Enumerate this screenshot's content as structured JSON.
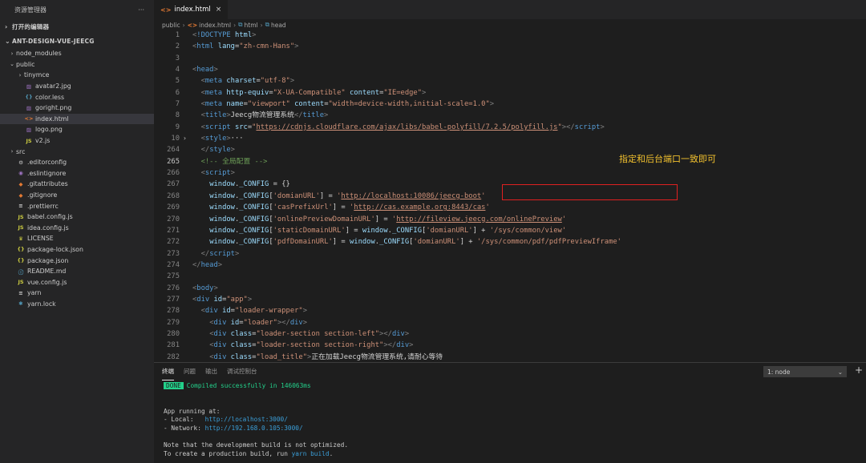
{
  "sidebar": {
    "title": "资源管理器",
    "more": "···",
    "open_editors": "打开的编辑器",
    "project": "ANT-DESIGN-VUE-JEECG",
    "items": [
      {
        "label": "node_modules",
        "chev": "›",
        "icon": "",
        "level": 0,
        "color": "#cccccc"
      },
      {
        "label": "public",
        "chev": "⌄",
        "icon": "",
        "level": 0,
        "color": "#cccccc"
      },
      {
        "label": "tinymce",
        "chev": "›",
        "icon": "",
        "level": 1,
        "color": "#cccccc"
      },
      {
        "label": "avatar2.jpg",
        "chev": "",
        "icon": "▨",
        "level": 1,
        "color": "#a074c4"
      },
      {
        "label": "color.less",
        "chev": "",
        "icon": "{}",
        "level": 1,
        "color": "#519aba"
      },
      {
        "label": "goright.png",
        "chev": "",
        "icon": "▨",
        "level": 1,
        "color": "#a074c4"
      },
      {
        "label": "index.html",
        "chev": "",
        "icon": "<>",
        "level": 1,
        "color": "#e37933",
        "selected": true
      },
      {
        "label": "logo.png",
        "chev": "",
        "icon": "▨",
        "level": 1,
        "color": "#a074c4"
      },
      {
        "label": "v2.js",
        "chev": "",
        "icon": "JS",
        "level": 1,
        "color": "#cbcb41"
      },
      {
        "label": "src",
        "chev": "›",
        "icon": "",
        "level": 0,
        "color": "#cccccc"
      },
      {
        "label": ".editorconfig",
        "chev": "",
        "icon": "⚙",
        "level": 0,
        "color": "#cccccc"
      },
      {
        "label": ".eslintignore",
        "chev": "",
        "icon": "◉",
        "level": 0,
        "color": "#a074c4"
      },
      {
        "label": ".gitattributes",
        "chev": "",
        "icon": "◆",
        "level": 0,
        "color": "#e37933"
      },
      {
        "label": ".gitignore",
        "chev": "",
        "icon": "◆",
        "level": 0,
        "color": "#e37933"
      },
      {
        "label": ".prettierrc",
        "chev": "",
        "icon": "≡",
        "level": 0,
        "color": "#cccccc"
      },
      {
        "label": "babel.config.js",
        "chev": "",
        "icon": "JS",
        "level": 0,
        "color": "#cbcb41"
      },
      {
        "label": "idea.config.js",
        "chev": "",
        "icon": "JS",
        "level": 0,
        "color": "#cbcb41"
      },
      {
        "label": "LICENSE",
        "chev": "",
        "icon": "♛",
        "level": 0,
        "color": "#cbcb41"
      },
      {
        "label": "package-lock.json",
        "chev": "",
        "icon": "{}",
        "level": 0,
        "color": "#cbcb41"
      },
      {
        "label": "package.json",
        "chev": "",
        "icon": "{}",
        "level": 0,
        "color": "#cbcb41"
      },
      {
        "label": "README.md",
        "chev": "",
        "icon": "ⓘ",
        "level": 0,
        "color": "#519aba"
      },
      {
        "label": "vue.config.js",
        "chev": "",
        "icon": "JS",
        "level": 0,
        "color": "#cbcb41"
      },
      {
        "label": "yarn",
        "chev": "",
        "icon": "≡",
        "level": 0,
        "color": "#cccccc"
      },
      {
        "label": "yarn.lock",
        "chev": "",
        "icon": "✱",
        "level": 0,
        "color": "#519aba"
      }
    ]
  },
  "tab": {
    "icon": "<>",
    "label": "index.html",
    "close": "×"
  },
  "breadcrumb": [
    "public",
    "index.html",
    "html",
    "head"
  ],
  "code_lines": [
    {
      "n": "1",
      "segs": [
        [
          "punc",
          "<"
        ],
        [
          "tag",
          "!DOCTYPE"
        ],
        [
          "txt",
          " "
        ],
        [
          "attr",
          "html"
        ],
        [
          "punc",
          ">"
        ]
      ]
    },
    {
      "n": "2",
      "segs": [
        [
          "punc",
          "<"
        ],
        [
          "tag",
          "html"
        ],
        [
          "txt",
          " "
        ],
        [
          "attr",
          "lang"
        ],
        [
          "txt",
          "="
        ],
        [
          "str",
          "\"zh-cmn-Hans\""
        ],
        [
          "punc",
          ">"
        ]
      ]
    },
    {
      "n": "3",
      "segs": []
    },
    {
      "n": "4",
      "segs": [
        [
          "punc",
          "<"
        ],
        [
          "tag",
          "head"
        ],
        [
          "punc",
          ">"
        ]
      ]
    },
    {
      "n": "5",
      "segs": [
        [
          "txt",
          "  "
        ],
        [
          "punc",
          "<"
        ],
        [
          "tag",
          "meta"
        ],
        [
          "txt",
          " "
        ],
        [
          "attr",
          "charset"
        ],
        [
          "txt",
          "="
        ],
        [
          "str",
          "\"utf-8\""
        ],
        [
          "punc",
          ">"
        ]
      ]
    },
    {
      "n": "6",
      "segs": [
        [
          "txt",
          "  "
        ],
        [
          "punc",
          "<"
        ],
        [
          "tag",
          "meta"
        ],
        [
          "txt",
          " "
        ],
        [
          "attr",
          "http-equiv"
        ],
        [
          "txt",
          "="
        ],
        [
          "str",
          "\"X-UA-Compatible\""
        ],
        [
          "txt",
          " "
        ],
        [
          "attr",
          "content"
        ],
        [
          "txt",
          "="
        ],
        [
          "str",
          "\"IE=edge\""
        ],
        [
          "punc",
          ">"
        ]
      ]
    },
    {
      "n": "7",
      "segs": [
        [
          "txt",
          "  "
        ],
        [
          "punc",
          "<"
        ],
        [
          "tag",
          "meta"
        ],
        [
          "txt",
          " "
        ],
        [
          "attr",
          "name"
        ],
        [
          "txt",
          "="
        ],
        [
          "str",
          "\"viewport\""
        ],
        [
          "txt",
          " "
        ],
        [
          "attr",
          "content"
        ],
        [
          "txt",
          "="
        ],
        [
          "str",
          "\"width=device-width,initial-scale=1.0\""
        ],
        [
          "punc",
          ">"
        ]
      ]
    },
    {
      "n": "8",
      "segs": [
        [
          "txt",
          "  "
        ],
        [
          "punc",
          "<"
        ],
        [
          "tag",
          "title"
        ],
        [
          "punc",
          ">"
        ],
        [
          "txt",
          "Jeecg物流管理系统"
        ],
        [
          "punc",
          "</"
        ],
        [
          "tag",
          "title"
        ],
        [
          "punc",
          ">"
        ]
      ]
    },
    {
      "n": "9",
      "segs": [
        [
          "txt",
          "  "
        ],
        [
          "punc",
          "<"
        ],
        [
          "tag",
          "script"
        ],
        [
          "txt",
          " "
        ],
        [
          "attr",
          "src"
        ],
        [
          "txt",
          "="
        ],
        [
          "str",
          "\""
        ],
        [
          "url",
          "https://cdnjs.cloudflare.com/ajax/libs/babel-polyfill/7.2.5/polyfill.js"
        ],
        [
          "str",
          "\""
        ],
        [
          "punc",
          "></"
        ],
        [
          "tag",
          "script"
        ],
        [
          "punc",
          ">"
        ]
      ]
    },
    {
      "n": "10",
      "fold": "›",
      "segs": [
        [
          "txt",
          "  "
        ],
        [
          "punc",
          "<"
        ],
        [
          "tag",
          "style"
        ],
        [
          "punc",
          ">"
        ],
        [
          "txt",
          "···"
        ]
      ]
    },
    {
      "n": "264",
      "segs": [
        [
          "txt",
          "  "
        ],
        [
          "punc",
          "</"
        ],
        [
          "tag",
          "style"
        ],
        [
          "punc",
          ">"
        ]
      ]
    },
    {
      "n": "265",
      "active": true,
      "segs": [
        [
          "txt",
          "  "
        ],
        [
          "cmt",
          "<!-- 全局配置 -->"
        ]
      ]
    },
    {
      "n": "266",
      "segs": [
        [
          "txt",
          "  "
        ],
        [
          "punc",
          "<"
        ],
        [
          "tag",
          "script"
        ],
        [
          "punc",
          ">"
        ]
      ]
    },
    {
      "n": "267",
      "segs": [
        [
          "txt",
          "    "
        ],
        [
          "prop",
          "window"
        ],
        [
          "txt",
          "."
        ],
        [
          "prop",
          "_CONFIG"
        ],
        [
          "txt",
          " = {}"
        ]
      ]
    },
    {
      "n": "268",
      "segs": [
        [
          "txt",
          "    "
        ],
        [
          "prop",
          "window"
        ],
        [
          "txt",
          "."
        ],
        [
          "prop",
          "_CONFIG"
        ],
        [
          "txt",
          "["
        ],
        [
          "str",
          "'domianURL'"
        ],
        [
          "txt",
          "] = "
        ],
        [
          "str",
          "'"
        ],
        [
          "url",
          "http://localhost:10086/jeecg-boot"
        ],
        [
          "str",
          "'"
        ]
      ]
    },
    {
      "n": "269",
      "segs": [
        [
          "txt",
          "    "
        ],
        [
          "prop",
          "window"
        ],
        [
          "txt",
          "."
        ],
        [
          "prop",
          "_CONFIG"
        ],
        [
          "txt",
          "["
        ],
        [
          "str",
          "'casPrefixUrl'"
        ],
        [
          "txt",
          "] = "
        ],
        [
          "str",
          "'"
        ],
        [
          "url",
          "http://cas.example.org:8443/cas"
        ],
        [
          "str",
          "'"
        ]
      ]
    },
    {
      "n": "270",
      "segs": [
        [
          "txt",
          "    "
        ],
        [
          "prop",
          "window"
        ],
        [
          "txt",
          "."
        ],
        [
          "prop",
          "_CONFIG"
        ],
        [
          "txt",
          "["
        ],
        [
          "str",
          "'onlinePreviewDomainURL'"
        ],
        [
          "txt",
          "] = "
        ],
        [
          "str",
          "'"
        ],
        [
          "url",
          "http://fileview.jeecg.com/onlinePreview"
        ],
        [
          "str",
          "'"
        ]
      ]
    },
    {
      "n": "271",
      "segs": [
        [
          "txt",
          "    "
        ],
        [
          "prop",
          "window"
        ],
        [
          "txt",
          "."
        ],
        [
          "prop",
          "_CONFIG"
        ],
        [
          "txt",
          "["
        ],
        [
          "str",
          "'staticDomainURL'"
        ],
        [
          "txt",
          "] = "
        ],
        [
          "prop",
          "window"
        ],
        [
          "txt",
          "."
        ],
        [
          "prop",
          "_CONFIG"
        ],
        [
          "txt",
          "["
        ],
        [
          "str",
          "'domianURL'"
        ],
        [
          "txt",
          "] + "
        ],
        [
          "str",
          "'/sys/common/view'"
        ]
      ]
    },
    {
      "n": "272",
      "segs": [
        [
          "txt",
          "    "
        ],
        [
          "prop",
          "window"
        ],
        [
          "txt",
          "."
        ],
        [
          "prop",
          "_CONFIG"
        ],
        [
          "txt",
          "["
        ],
        [
          "str",
          "'pdfDomainURL'"
        ],
        [
          "txt",
          "] = "
        ],
        [
          "prop",
          "window"
        ],
        [
          "txt",
          "."
        ],
        [
          "prop",
          "_CONFIG"
        ],
        [
          "txt",
          "["
        ],
        [
          "str",
          "'domianURL'"
        ],
        [
          "txt",
          "] + "
        ],
        [
          "str",
          "'/sys/common/pdf/pdfPreviewIframe'"
        ]
      ]
    },
    {
      "n": "273",
      "segs": [
        [
          "txt",
          "  "
        ],
        [
          "punc",
          "</"
        ],
        [
          "tag",
          "script"
        ],
        [
          "punc",
          ">"
        ]
      ]
    },
    {
      "n": "274",
      "segs": [
        [
          "punc",
          "</"
        ],
        [
          "tag",
          "head"
        ],
        [
          "punc",
          ">"
        ]
      ]
    },
    {
      "n": "275",
      "segs": []
    },
    {
      "n": "276",
      "segs": [
        [
          "punc",
          "<"
        ],
        [
          "tag",
          "body"
        ],
        [
          "punc",
          ">"
        ]
      ]
    },
    {
      "n": "277",
      "segs": [
        [
          "punc",
          "<"
        ],
        [
          "tag",
          "div"
        ],
        [
          "txt",
          " "
        ],
        [
          "attr",
          "id"
        ],
        [
          "txt",
          "="
        ],
        [
          "str",
          "\"app\""
        ],
        [
          "punc",
          ">"
        ]
      ]
    },
    {
      "n": "278",
      "segs": [
        [
          "txt",
          "  "
        ],
        [
          "punc",
          "<"
        ],
        [
          "tag",
          "div"
        ],
        [
          "txt",
          " "
        ],
        [
          "attr",
          "id"
        ],
        [
          "txt",
          "="
        ],
        [
          "str",
          "\"loader-wrapper\""
        ],
        [
          "punc",
          ">"
        ]
      ]
    },
    {
      "n": "279",
      "segs": [
        [
          "txt",
          "    "
        ],
        [
          "punc",
          "<"
        ],
        [
          "tag",
          "div"
        ],
        [
          "txt",
          " "
        ],
        [
          "attr",
          "id"
        ],
        [
          "txt",
          "="
        ],
        [
          "str",
          "\"loader\""
        ],
        [
          "punc",
          "></"
        ],
        [
          "tag",
          "div"
        ],
        [
          "punc",
          ">"
        ]
      ]
    },
    {
      "n": "280",
      "segs": [
        [
          "txt",
          "    "
        ],
        [
          "punc",
          "<"
        ],
        [
          "tag",
          "div"
        ],
        [
          "txt",
          " "
        ],
        [
          "attr",
          "class"
        ],
        [
          "txt",
          "="
        ],
        [
          "str",
          "\"loader-section section-left\""
        ],
        [
          "punc",
          "></"
        ],
        [
          "tag",
          "div"
        ],
        [
          "punc",
          ">"
        ]
      ]
    },
    {
      "n": "281",
      "segs": [
        [
          "txt",
          "    "
        ],
        [
          "punc",
          "<"
        ],
        [
          "tag",
          "div"
        ],
        [
          "txt",
          " "
        ],
        [
          "attr",
          "class"
        ],
        [
          "txt",
          "="
        ],
        [
          "str",
          "\"loader-section section-right\""
        ],
        [
          "punc",
          "></"
        ],
        [
          "tag",
          "div"
        ],
        [
          "punc",
          ">"
        ]
      ]
    },
    {
      "n": "282",
      "segs": [
        [
          "txt",
          "    "
        ],
        [
          "punc",
          "<"
        ],
        [
          "tag",
          "div"
        ],
        [
          "txt",
          " "
        ],
        [
          "attr",
          "class"
        ],
        [
          "txt",
          "="
        ],
        [
          "str",
          "\"load_title\""
        ],
        [
          "punc",
          ">"
        ],
        [
          "txt",
          "正在加载Jeecg物流管理系统,请耐心等待"
        ]
      ]
    }
  ],
  "annotation": "指定和后台端口一致即可",
  "colors": {
    "highlight": "#e02020",
    "annotation": "#f2c12e",
    "done": "#23d18b"
  },
  "panel": {
    "tabs": [
      "终端",
      "问题",
      "输出",
      "调试控制台"
    ],
    "select_value": "1: node",
    "select_arrow": "⌄",
    "add": "+",
    "term": {
      "done": "DONE",
      "compiled": "Compiled successfully in 146063ms",
      "running": "App running at:",
      "local_label": "- Local:   ",
      "local_url": "http://localhost:3000/",
      "network_label": "- Network: ",
      "network_url": "http://192.168.0.105:3000/",
      "note": "Note that the development build is not optimized.",
      "prod_pre": "To create a production build, run ",
      "prod_cmd": "yarn build",
      "prod_post": "."
    }
  }
}
